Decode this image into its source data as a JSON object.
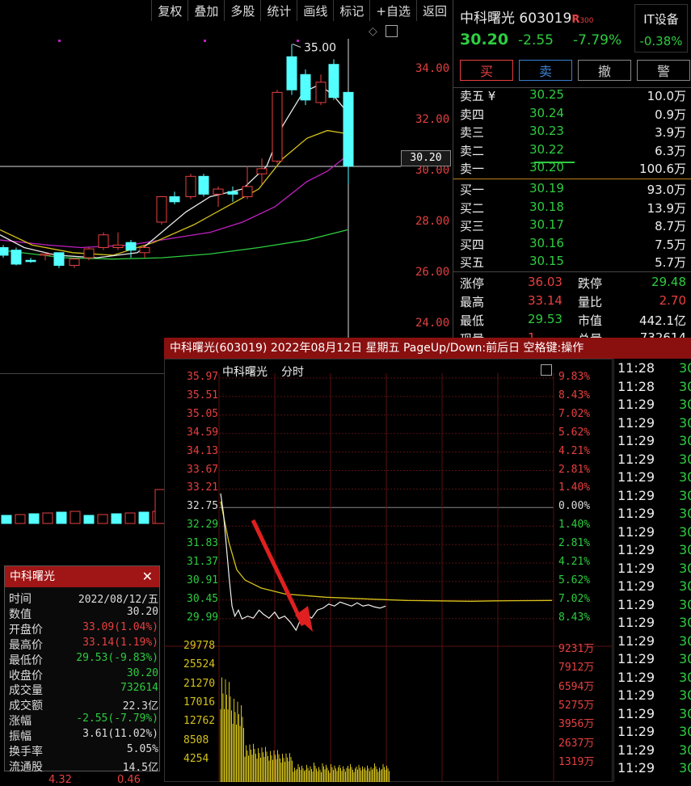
{
  "toolbar": {
    "items": [
      "复权",
      "叠加",
      "多股",
      "统计",
      "画线",
      "标记",
      "+自选",
      "返回"
    ]
  },
  "kline": {
    "price_ticks": [
      "34.00",
      "32.00",
      "30.00",
      "28.00",
      "26.00",
      "24.00"
    ],
    "current_price_tag": "30.20",
    "high_label": "35.00",
    "candles": [
      {
        "o": 27.0,
        "h": 27.1,
        "l": 26.6,
        "c": 26.7
      },
      {
        "o": 26.9,
        "h": 27.0,
        "l": 26.3,
        "c": 26.35
      },
      {
        "o": 26.5,
        "h": 26.6,
        "l": 26.4,
        "c": 26.45
      },
      {
        "o": 26.7,
        "h": 26.8,
        "l": 26.5,
        "c": 26.75
      },
      {
        "o": 26.8,
        "h": 26.8,
        "l": 26.2,
        "c": 26.3
      },
      {
        "o": 26.3,
        "h": 26.6,
        "l": 26.2,
        "c": 26.55
      },
      {
        "o": 26.6,
        "h": 27.0,
        "l": 26.5,
        "c": 26.95
      },
      {
        "o": 27.0,
        "h": 27.6,
        "l": 26.9,
        "c": 27.5
      },
      {
        "o": 27.0,
        "h": 27.6,
        "l": 26.9,
        "c": 27.1
      },
      {
        "o": 27.2,
        "h": 27.3,
        "l": 26.6,
        "c": 26.9
      },
      {
        "o": 26.8,
        "h": 27.1,
        "l": 26.6,
        "c": 27.0
      },
      {
        "o": 28.0,
        "h": 29.0,
        "l": 27.9,
        "c": 29.0
      },
      {
        "o": 29.0,
        "h": 29.2,
        "l": 28.7,
        "c": 28.8
      },
      {
        "o": 29.0,
        "h": 29.9,
        "l": 28.9,
        "c": 29.8
      },
      {
        "o": 29.8,
        "h": 29.9,
        "l": 29.0,
        "c": 29.1
      },
      {
        "o": 29.1,
        "h": 29.4,
        "l": 28.6,
        "c": 29.3
      },
      {
        "o": 29.2,
        "h": 29.4,
        "l": 28.8,
        "c": 29.1
      },
      {
        "o": 29.0,
        "h": 30.2,
        "l": 28.9,
        "c": 29.4
      },
      {
        "o": 29.9,
        "h": 30.5,
        "l": 29.5,
        "c": 30.1
      },
      {
        "o": 30.4,
        "h": 33.2,
        "l": 30.3,
        "c": 33.1
      },
      {
        "o": 34.5,
        "h": 35.0,
        "l": 33.0,
        "c": 33.2
      },
      {
        "o": 33.8,
        "h": 34.0,
        "l": 32.6,
        "c": 32.8
      },
      {
        "o": 32.7,
        "h": 33.8,
        "l": 32.6,
        "c": 33.5
      },
      {
        "o": 34.2,
        "h": 34.4,
        "l": 32.8,
        "c": 32.9
      },
      {
        "o": 33.1,
        "h": 33.1,
        "l": 29.5,
        "c": 30.2
      }
    ]
  },
  "quote": {
    "name": "中科曙光",
    "code": "603019",
    "badge": "R",
    "badge2": "300",
    "price": "30.20",
    "change": "-2.55",
    "pct": "-7.79%",
    "sector": "IT设备",
    "sector_pct": "-0.38%"
  },
  "actions": [
    "买",
    "卖",
    "撤",
    "警"
  ],
  "orderbook": {
    "asks": [
      {
        "l": "卖五 ¥",
        "p": "30.25",
        "v": "10.0万"
      },
      {
        "l": "卖四",
        "p": "30.24",
        "v": "0.9万"
      },
      {
        "l": "卖三",
        "p": "30.23",
        "v": "3.9万"
      },
      {
        "l": "卖二",
        "p": "30.22",
        "v": "6.3万"
      },
      {
        "l": "卖一",
        "p": "30.20",
        "v": "100.6万"
      }
    ],
    "bids": [
      {
        "l": "买一",
        "p": "30.19",
        "v": "93.0万"
      },
      {
        "l": "买二",
        "p": "30.18",
        "v": "13.9万"
      },
      {
        "l": "买三",
        "p": "30.17",
        "v": "8.7万"
      },
      {
        "l": "买四",
        "p": "30.16",
        "v": "7.5万"
      },
      {
        "l": "买五",
        "p": "30.15",
        "v": "5.7万"
      }
    ]
  },
  "stats": [
    {
      "l1": "涨停",
      "v1": "36.03",
      "l2": "跌停",
      "v2": "29.48"
    },
    {
      "l1": "最高",
      "v1": "33.14",
      "l2": "量比",
      "v2": "2.70"
    },
    {
      "l1": "最低",
      "v1": "29.53",
      "l2": "市值",
      "v2": "442.1亿"
    },
    {
      "l1": "现量",
      "v1": "1",
      "l2": "总量",
      "v2": "732614"
    }
  ],
  "popup": {
    "header": "中科曙光(603019) 2022年08月12日 星期五 PageUp/Down:前后日 空格键:操作",
    "title": "中科曙光",
    "subtitle": "分时",
    "left_prices": [
      "35.97",
      "35.51",
      "35.05",
      "34.59",
      "34.13",
      "33.67",
      "33.21",
      "32.75",
      "32.29",
      "31.83",
      "31.37",
      "30.91",
      "30.45",
      "29.99"
    ],
    "right_pcts": [
      "9.83%",
      "8.43%",
      "7.02%",
      "5.62%",
      "4.21%",
      "2.81%",
      "1.40%",
      "0.00%",
      "1.40%",
      "2.81%",
      "4.21%",
      "5.62%",
      "7.02%",
      "8.43%"
    ],
    "vol_left": [
      "29778",
      "25524",
      "21270",
      "17016",
      "12762",
      "8508",
      "4254"
    ],
    "vol_right": [
      "9231万",
      "7912万",
      "6594万",
      "5275万",
      "3956万",
      "2637万",
      "1319万"
    ]
  },
  "info": {
    "title": "中科曙光",
    "rows": [
      {
        "l": "时间",
        "v": "2022/08/12/五",
        "c": "#ddd"
      },
      {
        "l": "数值",
        "v": "30.20",
        "c": "#ddd"
      },
      {
        "l": "开盘价",
        "v": "33.09(1.04%)",
        "c": "#e84040"
      },
      {
        "l": "最高价",
        "v": "33.14(1.19%)",
        "c": "#e84040"
      },
      {
        "l": "最低价",
        "v": "29.53(-9.83%)",
        "c": "#2ecc40"
      },
      {
        "l": "收盘价",
        "v": "30.20",
        "c": "#2ecc40"
      },
      {
        "l": "成交量",
        "v": "732614",
        "c": "#2ecc40"
      },
      {
        "l": "成交额",
        "v": "22.3亿",
        "c": "#ddd"
      },
      {
        "l": " 涨幅",
        "v": "-2.55(-7.79%)",
        "c": "#2ecc40"
      },
      {
        "l": " 振幅",
        "v": "3.61(11.02%)",
        "c": "#ddd"
      },
      {
        "l": "换手率",
        "v": "5.05%",
        "c": "#ddd"
      },
      {
        "l": "流通股",
        "v": "14.5亿",
        "c": "#ddd"
      }
    ]
  },
  "ticks": {
    "times": [
      "11:28",
      "11:28",
      "11:29",
      "11:29",
      "11:29",
      "11:29",
      "11:29",
      "11:29",
      "11:29",
      "11:29",
      "11:29",
      "11:29",
      "11:29",
      "11:29",
      "11:29",
      "11:29",
      "11:29",
      "11:29",
      "11:29",
      "11:29",
      "11:29",
      "11:29",
      "11:29"
    ],
    "price_partial": "30"
  },
  "bottom_partial": [
    "4.32",
    "0.46"
  ],
  "colors": {
    "up": "#e84040",
    "down": "#2ecc40",
    "cyan": "#54ffff",
    "yellow": "#d4c21a",
    "magenta": "#c020c0"
  }
}
